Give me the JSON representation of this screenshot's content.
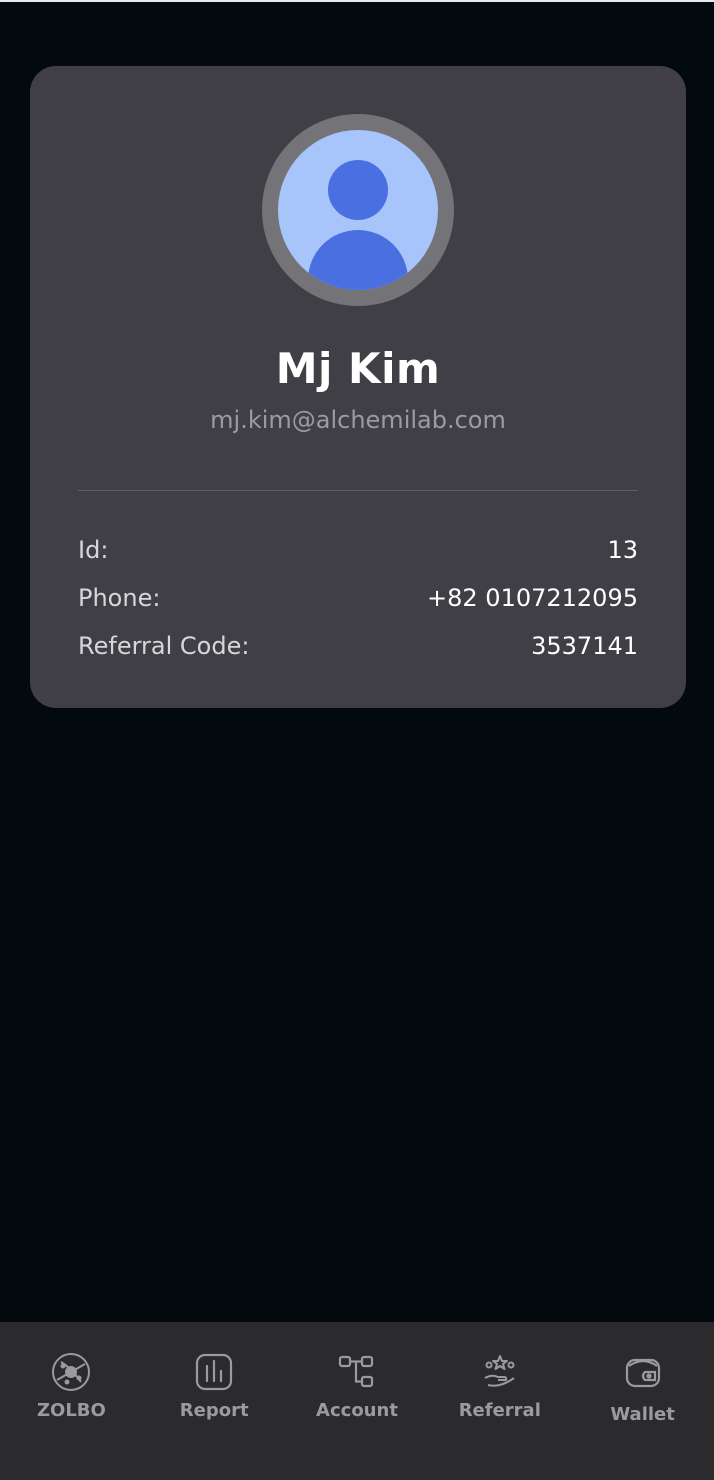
{
  "profile": {
    "name": "Mj Kim",
    "email": "mj.kim@alchemilab.com",
    "avatar_icon": "default-user-avatar-icon",
    "fields": [
      {
        "label": "Id:",
        "value": "13"
      },
      {
        "label": "Phone:",
        "value": "+82 0107212095"
      },
      {
        "label": "Referral Code:",
        "value": "3537141"
      }
    ]
  },
  "nav": {
    "items": [
      {
        "label": "ZOLBO",
        "icon": "zolbo-globe-icon"
      },
      {
        "label": "Report",
        "icon": "bar-chart-icon"
      },
      {
        "label": "Account",
        "icon": "hierarchy-icon"
      },
      {
        "label": "Referral",
        "icon": "hand-stars-icon"
      },
      {
        "label": "Wallet",
        "icon": "wallet-icon"
      }
    ]
  },
  "colors": {
    "background": "#030a0e",
    "card": "#3f3f45",
    "avatar_bg": "#a8c5fb",
    "avatar_fg": "#4a6fe0",
    "nav_bg": "#2b2b2d"
  }
}
